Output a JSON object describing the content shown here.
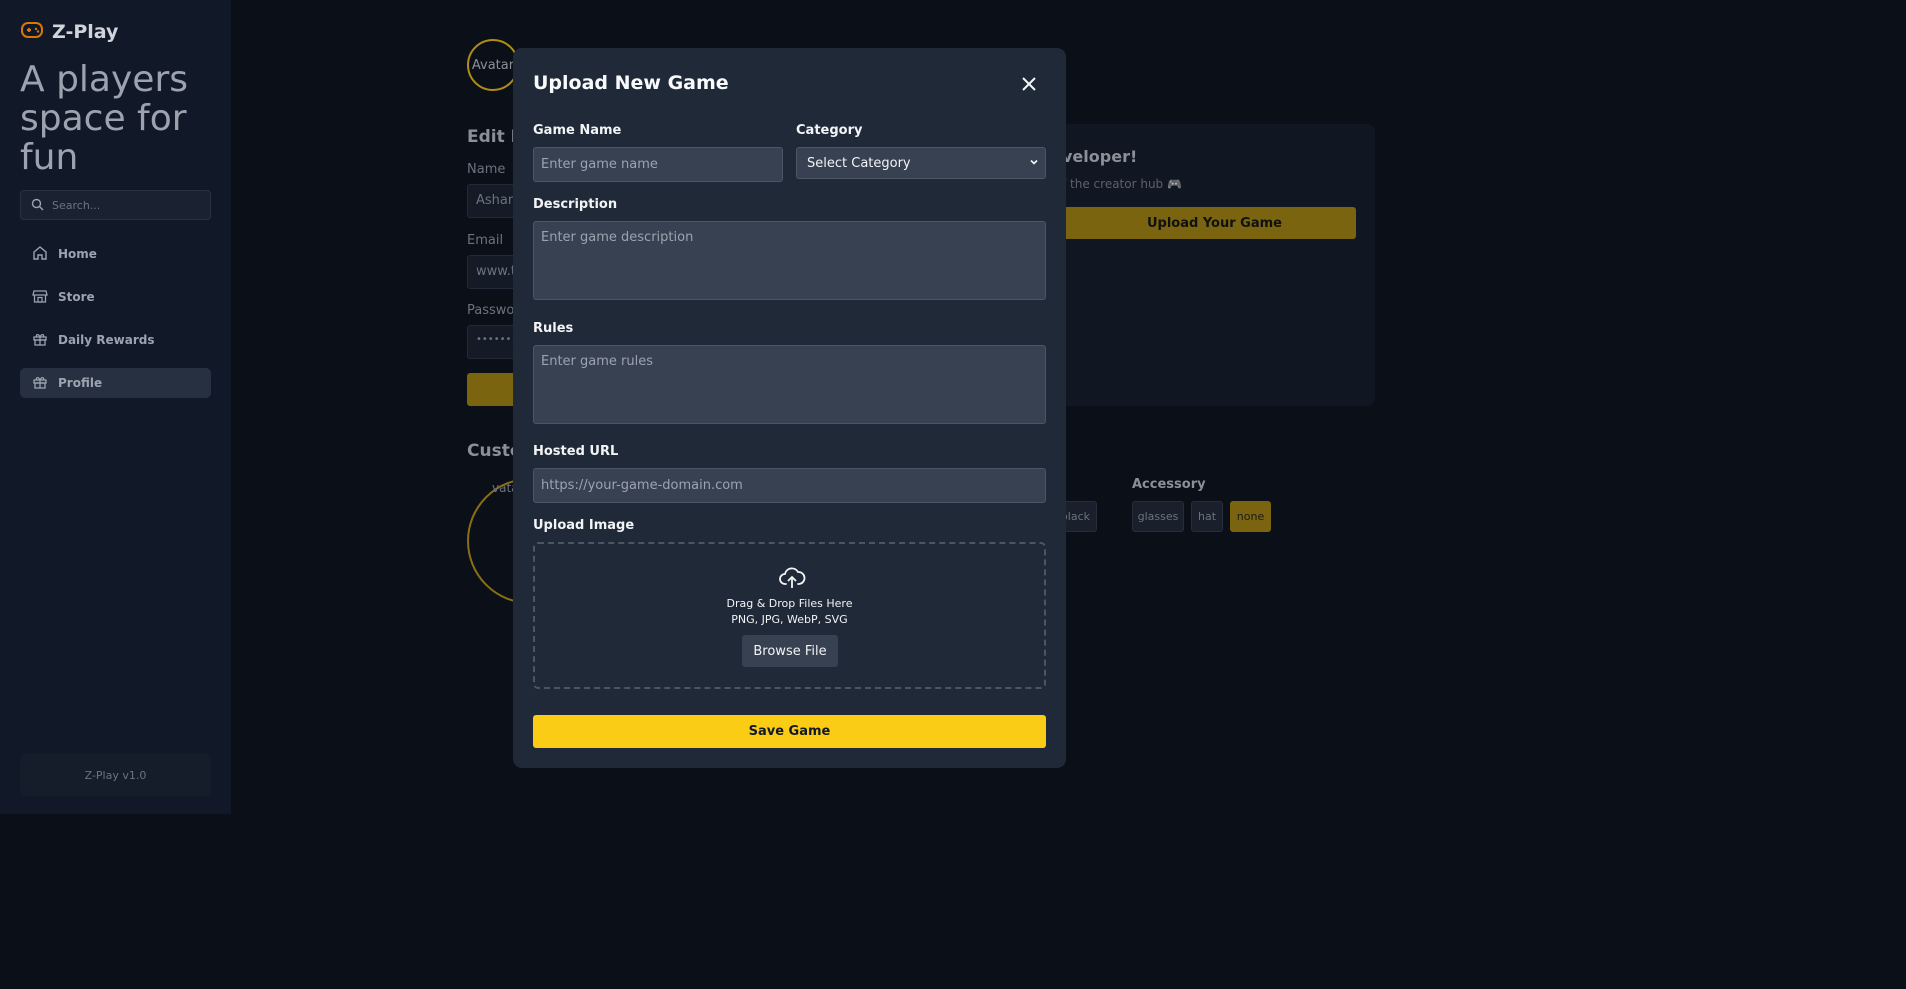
{
  "sidebar": {
    "brand": "Z-Play",
    "tagline": "A players space for fun",
    "search_placeholder": "Search...",
    "items": [
      {
        "label": "Home",
        "icon": "home-icon"
      },
      {
        "label": "Store",
        "icon": "store-icon"
      },
      {
        "label": "Daily Rewards",
        "icon": "gift-icon"
      },
      {
        "label": "Profile",
        "icon": "gift-icon"
      }
    ],
    "active_item": "Profile",
    "version": "Z-Play v1.0"
  },
  "background": {
    "avatar_text": "Avatar",
    "section_edit": "Edit P",
    "name_label": "Name",
    "name_value": "Ashani",
    "email_label": "Email",
    "email_value": "www.t",
    "password_label": "Passwor",
    "password_value": "•••••••••",
    "section_custom": "Custo",
    "big_avatar_text": "vata",
    "developer_title": "veloper!",
    "developer_sub": "f the creator hub 🎮",
    "upload_your_game": "Upload Your Game",
    "accessory_label": "Accessory",
    "chips": [
      "black",
      "glasses",
      "hat",
      "none"
    ],
    "selected_chip": "none"
  },
  "modal": {
    "title": "Upload New Game",
    "game_name_label": "Game Name",
    "game_name_placeholder": "Enter game name",
    "category_label": "Category",
    "category_selected": "Select Category",
    "description_label": "Description",
    "description_placeholder": "Enter game description",
    "rules_label": "Rules",
    "rules_placeholder": "Enter game rules",
    "hosted_url_label": "Hosted URL",
    "hosted_url_placeholder": "https://your-game-domain.com",
    "upload_image_label": "Upload Image",
    "drop_text": "Drag & Drop Files Here",
    "formats_text": "PNG, JPG, WebP, SVG",
    "browse_label": "Browse File",
    "save_label": "Save Game"
  },
  "colors": {
    "accent": "#facc15",
    "modal_bg": "#1f2937",
    "input_bg": "#374151",
    "sidebar_bg": "#111827"
  }
}
